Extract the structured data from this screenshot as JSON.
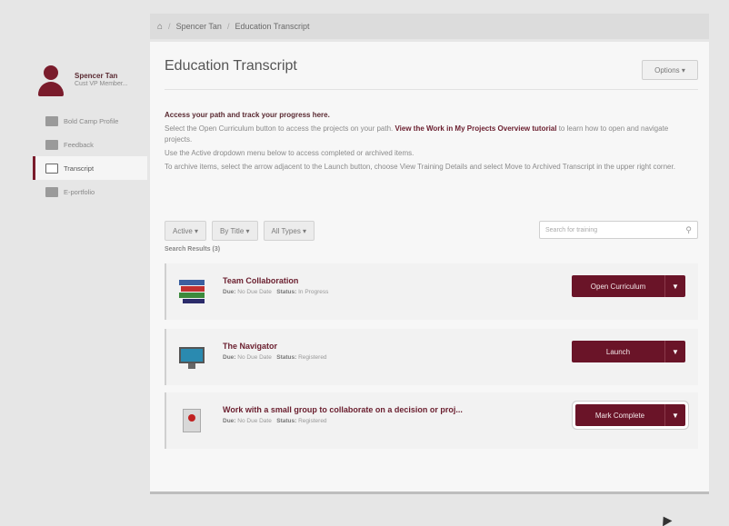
{
  "breadcrumb": {
    "home_icon": "home-icon",
    "items": [
      "Spencer Tan",
      "Education Transcript"
    ]
  },
  "sidebar": {
    "user": {
      "name": "Spencer Tan",
      "role": "Cust VP Member..."
    },
    "items": [
      {
        "label": "Bold Camp Profile",
        "icon": "profile-icon",
        "active": false
      },
      {
        "label": "Feedback",
        "icon": "feedback-icon",
        "active": false
      },
      {
        "label": "Transcript",
        "icon": "transcript-icon",
        "active": true
      },
      {
        "label": "E-portfolio",
        "icon": "portfolio-icon",
        "active": false
      }
    ]
  },
  "main": {
    "title": "Education Transcript",
    "options_label": "Options ▾",
    "intro": {
      "heading": "Access your path and track your progress here.",
      "para1_before": "Select the Open Curriculum button to access the projects on your path.",
      "para1_link": "View the Work in My Projects Overview tutorial",
      "para1_after": "to learn how to open and navigate projects.",
      "para2": "Use the Active dropdown menu below to access completed or archived items.",
      "para3": "To archive items, select the arrow adjacent to the Launch button, choose View Training Details and select Move to Archived Transcript in the upper right corner."
    },
    "filters": [
      "Active ▾",
      "By Title ▾",
      "All Types ▾"
    ],
    "search_placeholder": "Search for training",
    "results_label": "Search Results (3)",
    "cards": [
      {
        "title": "Team Collaboration",
        "due_label": "Due:",
        "due_value": "No Due Date",
        "status_label": "Status:",
        "status_value": "In Progress",
        "action": "Open Curriculum",
        "thumb": "books-icon"
      },
      {
        "title": "The Navigator",
        "due_label": "Due:",
        "due_value": "No Due Date",
        "status_label": "Status:",
        "status_value": "Registered",
        "action": "Launch",
        "thumb": "monitor-icon"
      },
      {
        "title": "Work with a small group to collaborate on a decision or proj...",
        "due_label": "Due:",
        "due_value": "No Due Date",
        "status_label": "Status:",
        "status_value": "Registered",
        "action": "Mark Complete",
        "thumb": "map-pin-icon"
      }
    ]
  },
  "colors": {
    "brand": "#6a1428",
    "background": "#e6e6e6",
    "panel": "#f7f7f7"
  }
}
